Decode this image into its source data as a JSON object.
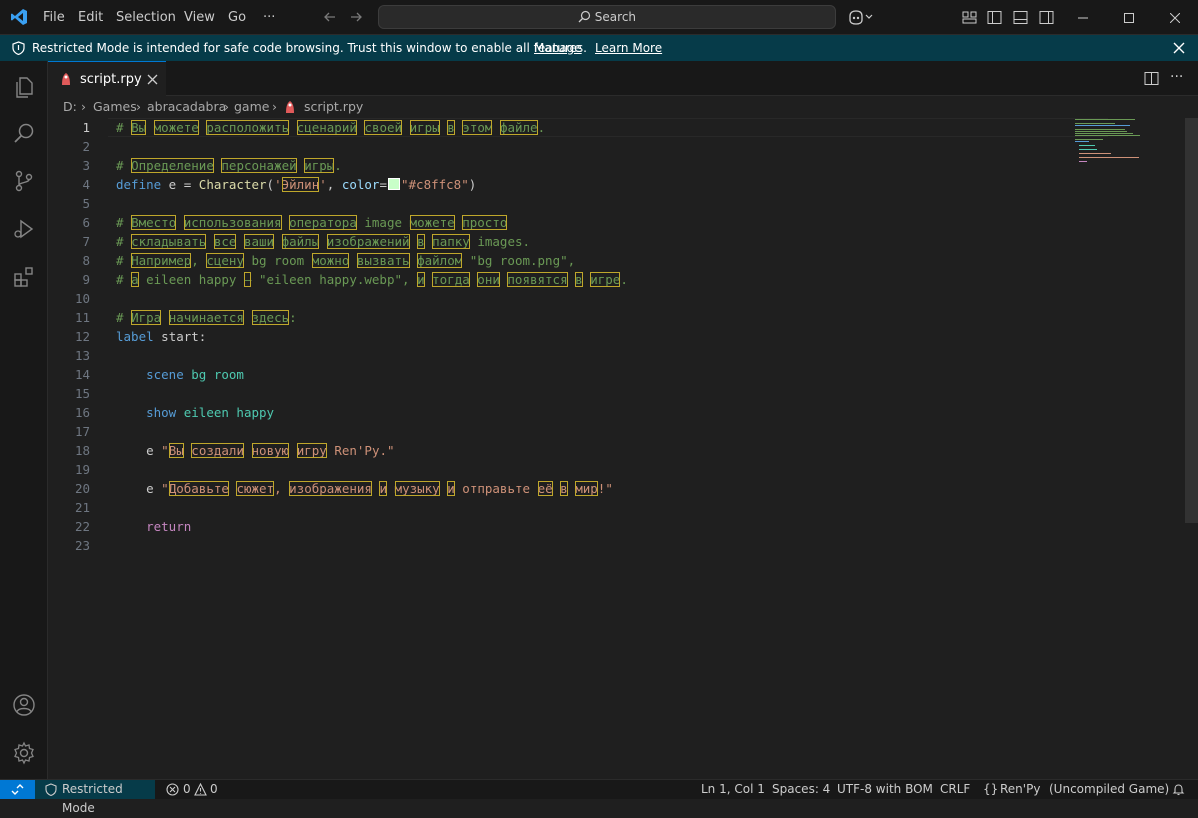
{
  "titlebar": {
    "menu": [
      "File",
      "Edit",
      "Selection",
      "View",
      "Go"
    ],
    "more": "···",
    "search_label": "Search"
  },
  "banner": {
    "message": "Restricted Mode is intended for safe code browsing. Trust this window to enable all features.",
    "manage": "Manage",
    "learn_more": "Learn More"
  },
  "tab": {
    "label": "script.rpy"
  },
  "breadcrumb": [
    "D:",
    "Games",
    "abracadabra",
    "game",
    "script.rpy"
  ],
  "editor": {
    "line_numbers": [
      "1",
      "2",
      "3",
      "4",
      "5",
      "6",
      "7",
      "8",
      "9",
      "10",
      "11",
      "12",
      "13",
      "14",
      "15",
      "16",
      "17",
      "18",
      "19",
      "20",
      "21",
      "22",
      "23"
    ],
    "active_line": "1"
  },
  "status": {
    "restricted": "Restricted Mode",
    "errors": "0",
    "warnings": "0",
    "position": "Ln 1, Col 1",
    "spaces": "Spaces: 4",
    "encoding": "UTF-8 with BOM",
    "eol": "CRLF",
    "language": "Ren'Py",
    "extra": "(Uncompiled Game)"
  },
  "colors": {
    "accent": "#0078d4",
    "banner_bg": "#063b49",
    "comment": "#6a9955",
    "keyword": "#569cd6",
    "string": "#ce9178",
    "swatch": "#c8ffc8"
  }
}
